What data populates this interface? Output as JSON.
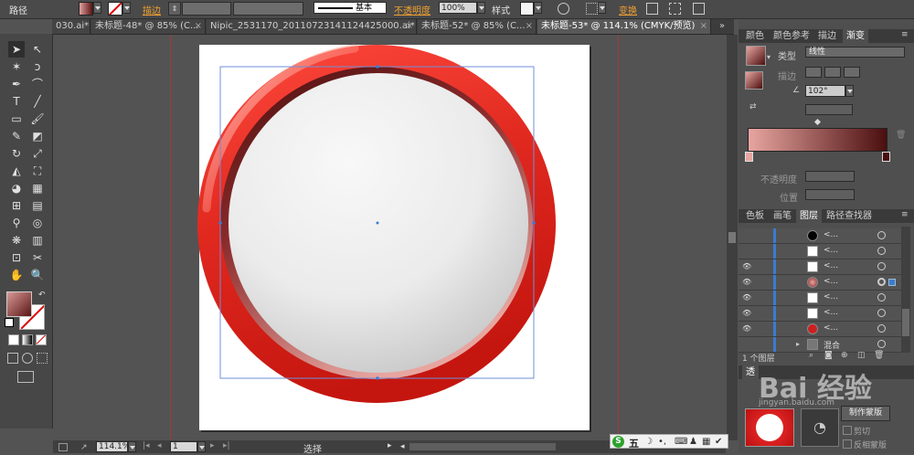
{
  "control_bar": {
    "path_label": "路径",
    "stroke_label": "描边",
    "stroke_style": "基本",
    "opacity_label": "不透明度",
    "opacity_value": "100%",
    "style_label": "样式",
    "transform_label": "变换"
  },
  "tabs": [
    {
      "label": "030.ai* @ ..."
    },
    {
      "label": "未标题-48* @ 85% (C..."
    },
    {
      "label": "Nipic_2531170_20110723141124425000.ai* ..."
    },
    {
      "label": "未标题-52* @ 85% (C..."
    },
    {
      "label": "未标题-53* @ 114.1% (CMYK/预览)"
    }
  ],
  "gradient_panel": {
    "tabs": [
      "颜色",
      "颜色参考",
      "描边",
      "渐变"
    ],
    "type_label": "类型",
    "type_value": "线性",
    "stroke_label": "描边",
    "angle_value": "102°",
    "opacity_label": "不透明度",
    "position_label": "位置"
  },
  "layers_panel": {
    "tabs": [
      "色板",
      "画笔",
      "图层",
      "路径查找器"
    ],
    "rows": [
      {
        "name": "<...",
        "thumb": "#000000"
      },
      {
        "name": "<...",
        "thumb": "#ffffff"
      },
      {
        "name": "<...",
        "thumb": "#ffffff"
      },
      {
        "name": "<...",
        "thumb": "#a03a3a"
      },
      {
        "name": "<...",
        "thumb": "#ffffff"
      },
      {
        "name": "<...",
        "thumb": "#ffffff"
      },
      {
        "name": "<...",
        "thumb": "#cc2020"
      },
      {
        "name": "混合",
        "thumb": "#888888"
      }
    ],
    "count_label": "1 个图层"
  },
  "transparency_panel": {
    "title_abbr": "透",
    "button_label": "制作蒙版",
    "clip_label": "剪切",
    "invert_label": "反相蒙版"
  },
  "status_bar": {
    "zoom_value": "114.1%",
    "page_value": "1",
    "tool_label": "选择"
  },
  "taskbar": {
    "ime_char": "五"
  },
  "watermark": {
    "text": "Bai 经验",
    "sub": "jingyan.baidu.com"
  },
  "colors": {
    "ring_red": "#d6211c",
    "gradient_start": "#e8a5a0",
    "gradient_end": "#4a0f0f",
    "accent_blue": "#3b7bd1"
  }
}
